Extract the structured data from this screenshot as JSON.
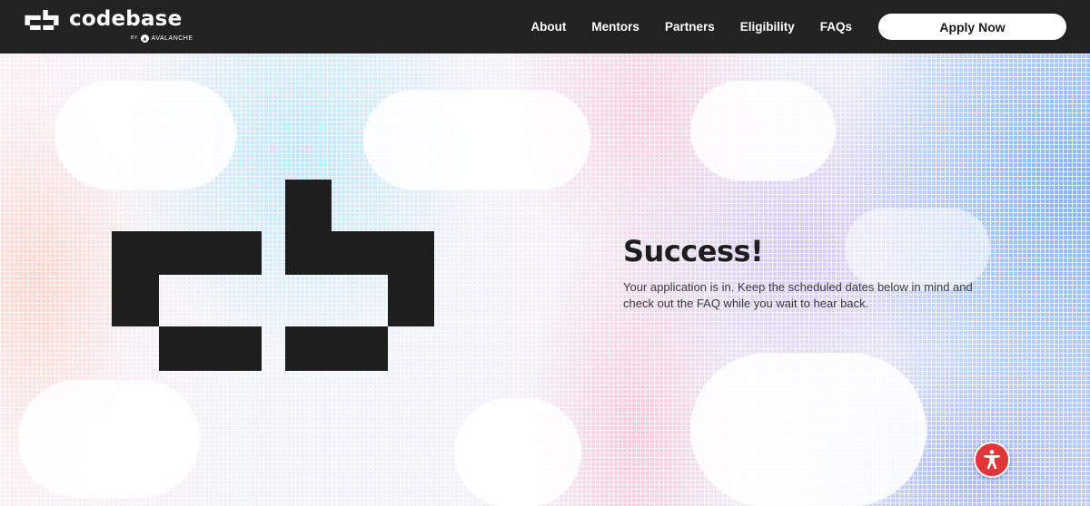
{
  "header": {
    "brand": "codebase",
    "brand_by": "BY",
    "brand_sub": "AVALANCHE",
    "nav": [
      "About",
      "Mentors",
      "Partners",
      "Eligibility",
      "FAQs"
    ],
    "apply_label": "Apply Now"
  },
  "main": {
    "title": "Success!",
    "message": "Your application is in. Keep the scheduled dates below in mind and check out the FAQ while you wait to hear back."
  },
  "icons": {
    "logo": "codebase-logo-icon",
    "avalanche": "avalanche-icon",
    "accessibility": "accessibility-icon"
  },
  "colors": {
    "header_bg": "#222222",
    "accent_red": "#e0363a",
    "text_dark": "#1d1d1d"
  }
}
